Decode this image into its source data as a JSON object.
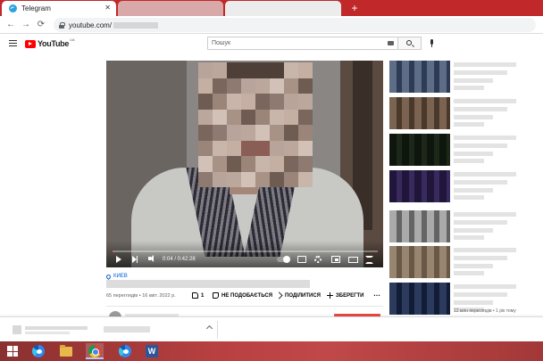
{
  "browser": {
    "tabs": [
      {
        "label": "Telegram"
      }
    ],
    "new_tab_label": "+",
    "address": "youtube.com/"
  },
  "youtube": {
    "logo_text": "YouTube",
    "region": "UA",
    "search_placeholder": "Пошук"
  },
  "player": {
    "time": "0:04 / 0:42:28",
    "progress_fraction": 0.002
  },
  "video": {
    "location": "КИЕВ",
    "meta": "65 переглядів • 16 квіт. 2022 р.",
    "likes": "1",
    "dislike_label": "НЕ ПОДОБАЄТЬСЯ",
    "share_label": "ПОДІЛИТИСЯ",
    "save_label": "ЗБЕРЕГТИ",
    "more_label": "…"
  },
  "sidebar": {
    "last_meta": "12 млн переглядів • 1 рік тому"
  },
  "taskbar": {
    "word_letter": "W"
  },
  "colors": {
    "tabstrip": "#c0282a",
    "youtube_red": "#ff0000",
    "link_blue": "#065fd4"
  }
}
